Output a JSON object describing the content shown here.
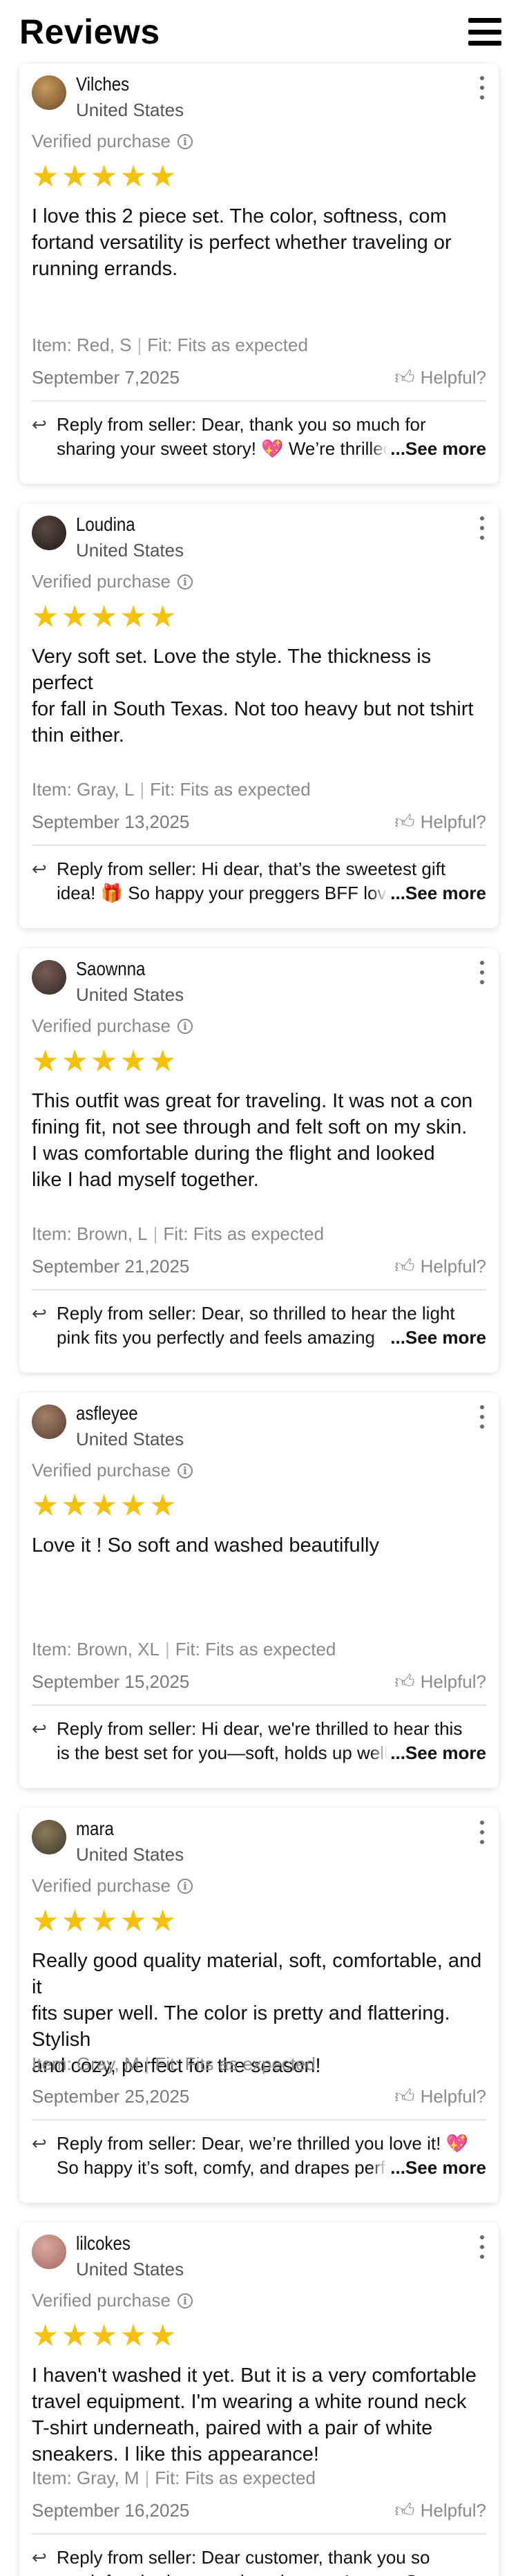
{
  "header": {
    "title": "Reviews"
  },
  "labels": {
    "verified": "Verified purchase",
    "helpful": "Helpful?",
    "see_more": "...See more",
    "reply_prefix": "Reply from seller: "
  },
  "colors": {
    "star": "#f4c20d",
    "muted": "#8a8a8a"
  },
  "reviews": [
    {
      "name": "Vilches",
      "country": "United States",
      "rating": 5,
      "body": "I love this 2 piece set. The color, softness, com\nfortand versatility is perfect whether traveling or\nrunning errands.",
      "item": "Item: Red, S",
      "fit": "Fit: Fits as expected",
      "date": "September 7,2025",
      "reply": "Dear, thank you so much for sharing your sweet story! 💖 We’re thrilled"
    },
    {
      "name": "Loudina",
      "country": "United States",
      "rating": 5,
      "body": "Very soft set. Love the style. The thickness is perfect\nfor fall in South Texas. Not too heavy but not tshirt\nthin either.",
      "item": "Item: Gray, L",
      "fit": "Fit: Fits as expected",
      "date": "September 13,2025",
      "reply": "Hi dear, that’s the sweetest gift idea! 🎁 So happy your preggers BFF loves it"
    },
    {
      "name": "Saownna",
      "country": "United States",
      "rating": 5,
      "body": "This outfit was great for traveling. It was not a con\nfining fit, not see through and felt soft on my skin.\nI was comfortable during the flight and looked\nlike I had myself together.",
      "item": "Item: Brown, L",
      "fit": "Fit: Fits as expected",
      "date": "September 21,2025",
      "reply": "Dear, so thrilled to hear the light pink fits you perfectly and feels amazing"
    },
    {
      "name": "asfleyee",
      "country": "United States",
      "rating": 5,
      "body": "Love it ! So soft and washed beautifully",
      "item": "Item: Brown, XL",
      "fit": "Fit: Fits as expected",
      "date": "September 15,2025",
      "reply": "Hi dear, we're thrilled to hear this is the best set for you—soft, holds up well"
    },
    {
      "name": "mara",
      "country": "United States",
      "rating": 5,
      "body": "Really good quality material, soft, comfortable, and it\nfits super well. The color is pretty and flattering. Stylish\nand cozy, perfect for the season!",
      "item": "Item: Gray, M",
      "fit": "Fit: Fits as expected",
      "date": "September 25,2025",
      "reply": "Dear, we’re thrilled you love it! 💖 So happy it’s soft, comfy, and drapes perfectly"
    },
    {
      "name": "lilcokes",
      "country": "United States",
      "rating": 5,
      "body": "I haven't washed it yet. But it is a very comfortable\ntravel equipment. I'm wearing a white round neck\nT-shirt underneath, paired with a pair of white\nsneakers. I like this appearance!",
      "item": "Item: Gray, M",
      "fit": "Fit: Fits as expected",
      "date": "September 16,2025",
      "reply": "Dear customer, thank you so much for sharing your thoughts—we’re so"
    }
  ]
}
